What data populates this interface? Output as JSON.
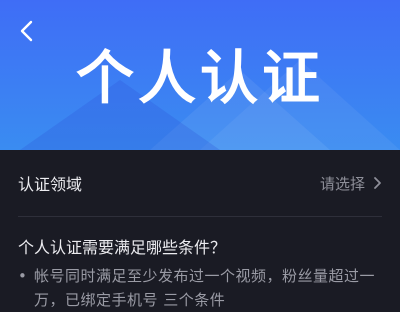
{
  "header": {
    "title": "个人认证",
    "back_icon": "chevron-left-icon"
  },
  "form": {
    "field_label": "认证领域",
    "field_value": "请选择",
    "chevron_icon": "chevron-right-icon"
  },
  "requirements": {
    "title": "个人认证需要满足哪些条件？",
    "items": [
      "帐号同时满足至少发布过一个视频，粉丝量超过一万，已绑定手机号 三个条件"
    ]
  },
  "colors": {
    "banner_top": "#3f6df6",
    "banner_bottom": "#3a8cf1",
    "page_bg": "#1a1b24"
  }
}
